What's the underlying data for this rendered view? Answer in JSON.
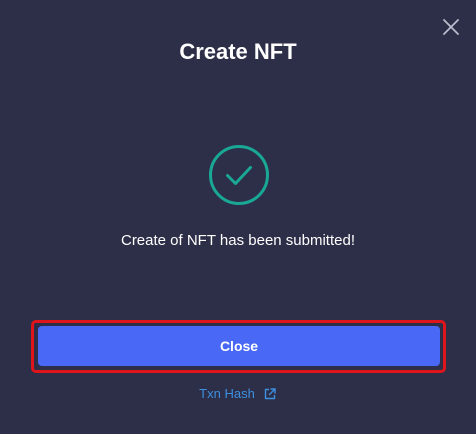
{
  "modal": {
    "title": "Create NFT",
    "message": "Create of NFT has been submitted!",
    "close_button_label": "Close",
    "txn_link_label": "Txn Hash"
  },
  "icons": {
    "dismiss": "close-x-icon",
    "status": "checkmark-circle-icon",
    "link": "external-link-icon"
  },
  "colors": {
    "background": "#2d2f48",
    "accent_button": "#4a68f6",
    "success": "#19a893",
    "link": "#3d8fe0",
    "highlight": "#e0151b"
  }
}
